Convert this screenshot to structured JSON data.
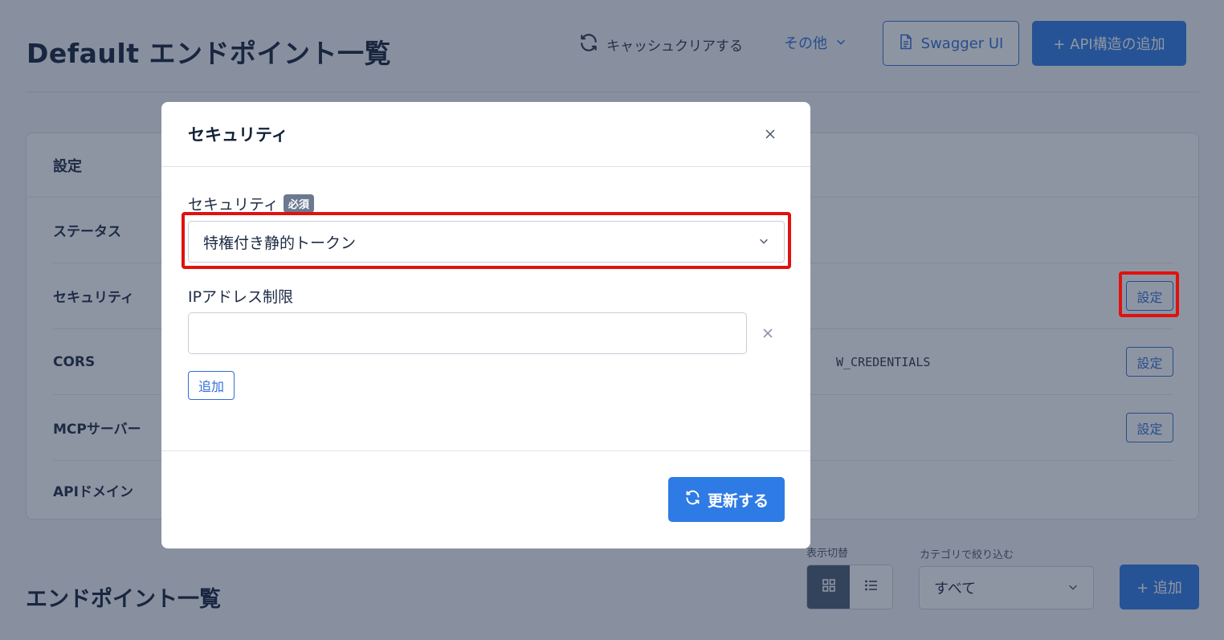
{
  "page": {
    "title": "Default エンドポイント一覧"
  },
  "header": {
    "cache_clear_label": "キャッシュクリアする",
    "more_label": "その他",
    "swagger_label": "Swagger UI",
    "add_api_label": "+ API構造の追加"
  },
  "settings": {
    "heading": "設定",
    "rows": [
      {
        "label": "ステータス",
        "value": "",
        "button": ""
      },
      {
        "label": "セキュリティ",
        "value": "",
        "button": "設定"
      },
      {
        "label": "CORS",
        "value": "W_CREDENTIALS",
        "button": "設定"
      },
      {
        "label": "MCPサーバー",
        "value": "",
        "button": "設定"
      },
      {
        "label": "APIドメイン",
        "value": "",
        "button": ""
      }
    ]
  },
  "endpoints": {
    "title": "エンドポイント一覧",
    "view_toggle_label": "表示切替",
    "category_label": "カテゴリで絞り込む",
    "category_selected": "すべて",
    "add_label": "+ 追加"
  },
  "modal": {
    "title": "セキュリティ",
    "security_label": "セキュリティ",
    "required_badge": "必須",
    "security_selected": "特権付き静的トークン",
    "ip_label": "IPアドレス制限",
    "ip_value": "",
    "ip_add_label": "追加",
    "update_label": "更新する"
  },
  "colors": {
    "accent": "#2f7be5",
    "highlight": "#e0120f",
    "overlay": "rgba(30, 44, 70, 0.5)"
  },
  "icons": [
    "refresh-icon",
    "chevron-down-icon",
    "document-icon",
    "grid-icon",
    "list-icon",
    "close-icon"
  ]
}
